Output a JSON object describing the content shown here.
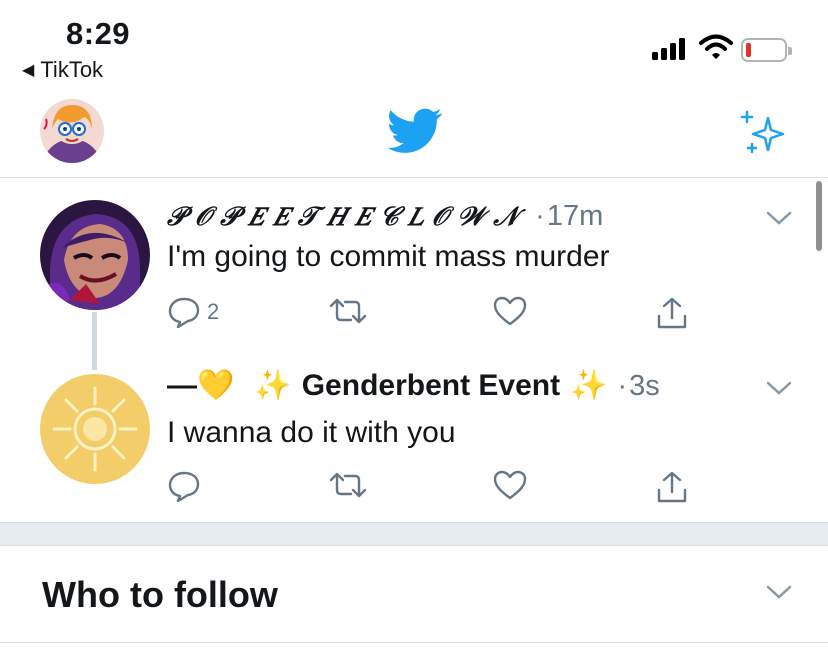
{
  "status_bar": {
    "time": "8:29",
    "back_app": "TikTok",
    "back_icon": "back-triangle-icon",
    "battery_color": "#e0322b"
  },
  "nav": {
    "bird_color": "#1da1f2",
    "sparkle_color": "#1da1f2"
  },
  "tweets": [
    {
      "display_name": "𝒫𝒪𝒫𝐸𝐸𝒯𝐻𝐸𝒞𝐿𝒪𝒲𝒩",
      "display_name_ascii": "P O P E E T H E C L O W N",
      "time": "17m",
      "text": "I'm going to commit mass murder",
      "reply_count": "2"
    },
    {
      "display_name_prefix": "—",
      "display_name_heart": "💛",
      "display_name_sparkle_left": "✨",
      "display_name": "Genderbent Event",
      "display_name_sparkle_right": "✨",
      "time": "3s",
      "text": "I wanna do it with you",
      "reply_count": ""
    }
  ],
  "who_to_follow": {
    "title": "Who to follow"
  },
  "colors": {
    "twitter_blue": "#1da1f2",
    "secondary_text": "#657786",
    "divider": "#e6ecf0"
  }
}
